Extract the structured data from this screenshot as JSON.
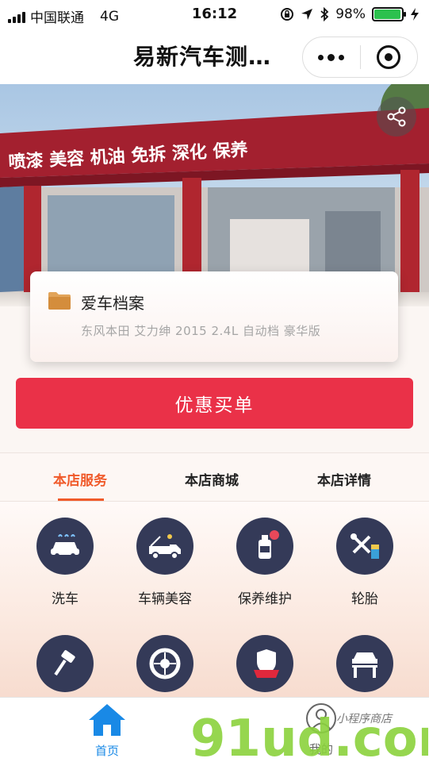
{
  "status_bar": {
    "carrier": "中国联通",
    "network": "4G",
    "time": "16:12",
    "battery": "98%",
    "battery_level": 0.98
  },
  "nav": {
    "title": "易新汽车测…"
  },
  "hero": {
    "sign_text": "喷漆 美容 机油 免拆 深化 保养"
  },
  "car_card": {
    "title": "爱车档案",
    "subtitle": "东风本田 艾力绅 2015 2.4L 自动档 豪华版"
  },
  "pay_button_label": "优惠买单",
  "tabs": [
    {
      "label": "本店服务",
      "active": true
    },
    {
      "label": "本店商城",
      "active": false
    },
    {
      "label": "本店详情",
      "active": false
    }
  ],
  "services": [
    {
      "label": "洗车",
      "icon": "car-wash-icon"
    },
    {
      "label": "车辆美容",
      "icon": "tow-truck-icon"
    },
    {
      "label": "保养维护",
      "icon": "oil-bottle-icon"
    },
    {
      "label": "轮胎",
      "icon": "tools-icon"
    },
    {
      "label": "",
      "icon": "hammer-icon"
    },
    {
      "label": "",
      "icon": "tire-icon"
    },
    {
      "label": "",
      "icon": "insurance-icon"
    },
    {
      "label": "",
      "icon": "car-lift-icon"
    }
  ],
  "tab_bar": {
    "home_label": "首页",
    "mine_label": "我的"
  },
  "watermark": {
    "text": "91ud.com",
    "small_text": "小程序商店"
  },
  "colors": {
    "accent_red": "#ea3148",
    "tab_active": "#f05a2a",
    "home_blue": "#1989e6",
    "icon_navy": "#343a58"
  }
}
